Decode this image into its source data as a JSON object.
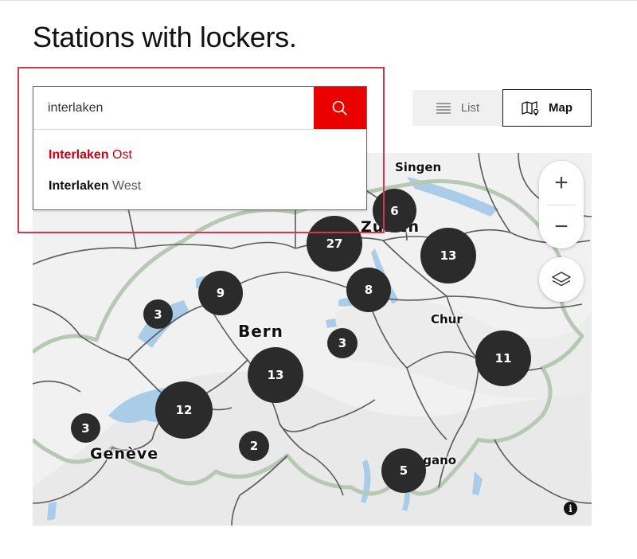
{
  "page": {
    "title": "Stations with lockers."
  },
  "search": {
    "value": "interlaken",
    "button": "search-icon",
    "suggestions": [
      {
        "bold": "Interlaken",
        "rest": " Ost",
        "selected": true
      },
      {
        "bold": "Interlaken",
        "rest": " West",
        "selected": false
      }
    ]
  },
  "view_toggle": {
    "list_label": "List",
    "map_label": "Map",
    "active": "Map"
  },
  "map": {
    "cities": [
      "Singen",
      "Zürich",
      "Bern",
      "Chur",
      "Genève",
      "Lugano"
    ],
    "clusters": [
      6,
      27,
      13,
      9,
      3,
      8,
      3,
      13,
      11,
      12,
      3,
      2,
      5
    ],
    "controls": {
      "zoom_in": "+",
      "zoom_out": "−",
      "layers": "layers-icon",
      "info": "i"
    }
  },
  "colors": {
    "accent": "#eb0000",
    "suggestion_active": "#c60018",
    "cluster": "#2b2b2b",
    "lake": "#a9cde8",
    "border_green": "#b7c8b5",
    "annotation_box": "#d4374b"
  }
}
